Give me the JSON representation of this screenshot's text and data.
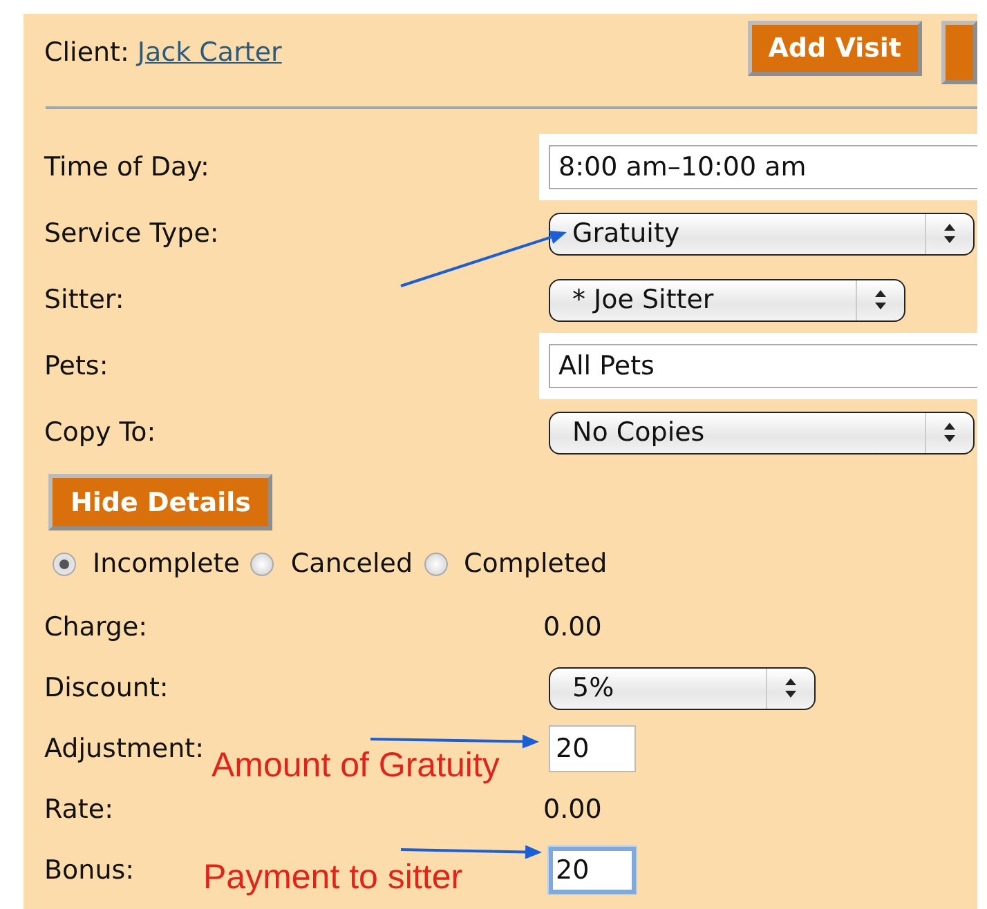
{
  "header": {
    "client_label": "Client:",
    "client_name": "Jack Carter",
    "buttons": [
      {
        "label": "Add Visit"
      }
    ]
  },
  "fields": [
    {
      "kind": "text",
      "label": "Time of Day:",
      "value": "8:00 am–10:00 am"
    },
    {
      "kind": "select",
      "label": "Service Type:",
      "value": "Gratuity"
    },
    {
      "kind": "select",
      "label": "Sitter:",
      "value": "* Joe Sitter"
    },
    {
      "kind": "text",
      "label": "Pets:",
      "value": "All Pets"
    },
    {
      "kind": "select",
      "label": "Copy To:",
      "value": "No Copies"
    }
  ],
  "toggle_button": {
    "label": "Hide Details"
  },
  "status": [
    {
      "label": "Incomplete",
      "selected": true
    },
    {
      "label": "Canceled",
      "selected": false
    },
    {
      "label": "Completed",
      "selected": false
    }
  ],
  "details": [
    {
      "kind": "value",
      "label": "Charge:",
      "value": "0.00"
    },
    {
      "kind": "select",
      "label": "Discount:",
      "value": "5%"
    },
    {
      "kind": "input",
      "label": "Adjustment:",
      "value": "20",
      "focused": false
    },
    {
      "kind": "value",
      "label": "Rate:",
      "value": "0.00"
    },
    {
      "kind": "input",
      "label": "Bonus:",
      "value": "20",
      "focused": true
    }
  ],
  "annotations": [
    {
      "text": "Amount of Gratuity"
    },
    {
      "text": "Payment to sitter"
    }
  ]
}
